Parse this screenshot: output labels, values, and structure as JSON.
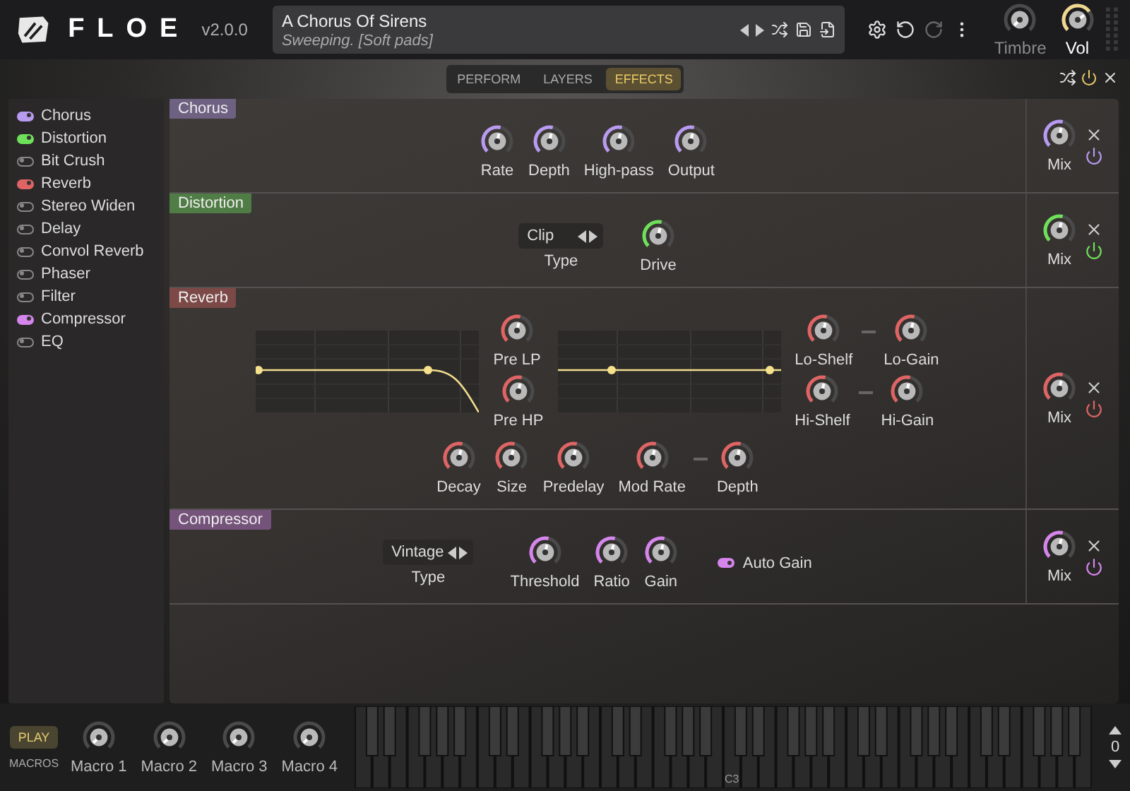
{
  "header": {
    "logo": "FLOE",
    "version": "v2.0.0",
    "preset": {
      "name": "A Chorus Of Sirens",
      "description": "Sweeping. [Soft pads]"
    },
    "knobs": [
      {
        "label": "Timbre",
        "disabled": true
      },
      {
        "label": "Vol",
        "disabled": false
      }
    ]
  },
  "tabs": [
    {
      "label": "PERFORM",
      "selected": false
    },
    {
      "label": "LAYERS",
      "selected": false
    },
    {
      "label": "EFFECTS",
      "selected": true
    }
  ],
  "effects_list": [
    {
      "name": "Chorus",
      "on": true,
      "color": "#b89af0"
    },
    {
      "name": "Distortion",
      "on": true,
      "color": "#6fe05a"
    },
    {
      "name": "Bit Crush",
      "on": false
    },
    {
      "name": "Reverb",
      "on": true,
      "color": "#e06464"
    },
    {
      "name": "Stereo Widen",
      "on": false
    },
    {
      "name": "Delay",
      "on": false
    },
    {
      "name": "Convol Reverb",
      "on": false
    },
    {
      "name": "Phaser",
      "on": false
    },
    {
      "name": "Filter",
      "on": false
    },
    {
      "name": "Compressor",
      "on": true,
      "color": "#d585ec"
    },
    {
      "name": "EQ",
      "on": false
    }
  ],
  "effects": [
    {
      "title": "Chorus",
      "color": "#b89af0",
      "on": true,
      "mix": {
        "label": "Mix"
      },
      "rows": [
        {
          "items": [
            {
              "kind": "knob",
              "label": "Rate"
            },
            {
              "kind": "knob",
              "label": "Depth"
            },
            {
              "kind": "knob",
              "label": "High-pass"
            },
            {
              "kind": "knob",
              "label": "Output"
            }
          ]
        }
      ]
    },
    {
      "title": "Distortion",
      "color": "#6fe05a",
      "on": true,
      "mix": {
        "label": "Mix"
      },
      "rows": [
        {
          "items": [
            {
              "kind": "selector",
              "value": "Clip",
              "label": "Type"
            },
            {
              "kind": "knob",
              "label": "Drive"
            }
          ]
        }
      ]
    },
    {
      "title": "Reverb",
      "color": "#e06464",
      "on": true,
      "mix": {
        "label": "Mix"
      },
      "rows": [
        {
          "items": [
            {
              "kind": "lowpass"
            },
            {
              "kind": "stack",
              "rows": [
                {
                  "items": [
                    {
                      "kind": "knob",
                      "label": "Pre LP"
                    }
                  ]
                },
                {
                  "items": [
                    {
                      "kind": "knob",
                      "label": "Pre HP"
                    }
                  ]
                }
              ]
            },
            {
              "kind": "eqgraph"
            },
            {
              "kind": "stack",
              "rows": [
                {
                  "items": [
                    {
                      "kind": "knob",
                      "label": "Lo-Shelf"
                    },
                    {
                      "kind": "link"
                    },
                    {
                      "kind": "knob",
                      "label": "Lo-Gain"
                    }
                  ]
                },
                {
                  "items": [
                    {
                      "kind": "knob",
                      "label": "Hi-Shelf"
                    },
                    {
                      "kind": "link"
                    },
                    {
                      "kind": "knob",
                      "label": "Hi-Gain"
                    }
                  ]
                }
              ]
            }
          ]
        },
        {
          "items": [
            {
              "kind": "knob",
              "label": "Decay"
            },
            {
              "kind": "knob",
              "label": "Size"
            },
            {
              "kind": "knob",
              "label": "Predelay"
            },
            {
              "kind": "knob",
              "label": "Mod Rate"
            },
            {
              "kind": "link"
            },
            {
              "kind": "knob",
              "label": "Depth"
            }
          ]
        }
      ]
    },
    {
      "title": "Compressor",
      "color": "#d585ec",
      "on": true,
      "mix": {
        "label": "Mix"
      },
      "rows": [
        {
          "items": [
            {
              "kind": "selector",
              "value": "Vintage",
              "label": "Type"
            },
            {
              "kind": "knob",
              "label": "Threshold"
            },
            {
              "kind": "knob",
              "label": "Ratio"
            },
            {
              "kind": "knob",
              "label": "Gain"
            },
            {
              "kind": "toggle",
              "label": "Auto Gain",
              "on": true
            }
          ]
        }
      ]
    }
  ],
  "bottom": {
    "play": "PLAY",
    "macros_label": "MACROS",
    "macros": [
      {
        "label": "Macro 1"
      },
      {
        "label": "Macro 2"
      },
      {
        "label": "Macro 3"
      },
      {
        "label": "Macro 4"
      }
    ],
    "key_label": "C3",
    "octave": "0"
  }
}
